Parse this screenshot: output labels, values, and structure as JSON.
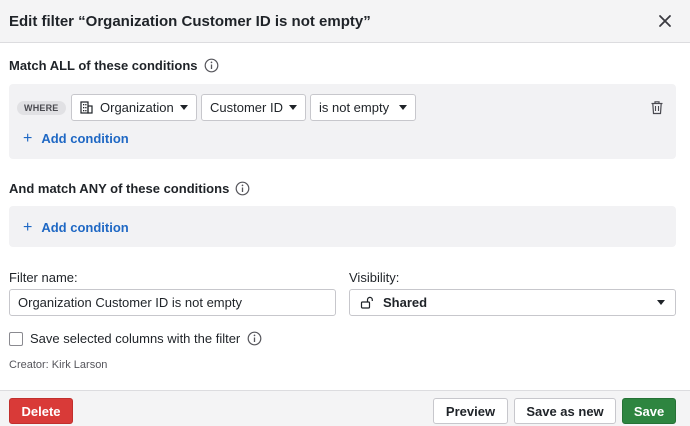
{
  "header": {
    "title": "Edit filter “Organization Customer ID is not empty”"
  },
  "match_all": {
    "label": "Match ALL of these conditions",
    "where_badge": "WHERE",
    "conditions": [
      {
        "object": "Organization",
        "field": "Customer ID",
        "operator": "is not empty"
      }
    ],
    "add_condition": "Add condition"
  },
  "match_any": {
    "label": "And match ANY of these conditions",
    "add_condition": "Add condition"
  },
  "filter_name": {
    "label": "Filter name:",
    "value": "Organization Customer ID is not empty"
  },
  "visibility": {
    "label": "Visibility:",
    "value": "Shared"
  },
  "save_columns": {
    "label": "Save selected columns with the filter",
    "checked": false
  },
  "creator": "Creator: Kirk Larson",
  "footer": {
    "delete": "Delete",
    "preview": "Preview",
    "save_as_new": "Save as new",
    "save": "Save"
  },
  "colors": {
    "accent_link": "#1f68c4",
    "delete": "#d93a38",
    "save": "#2e8540"
  },
  "icons": {
    "close": "close-icon",
    "info": "info-icon",
    "object": "building-icon",
    "trash": "trash-icon",
    "lock": "unlock-icon"
  }
}
